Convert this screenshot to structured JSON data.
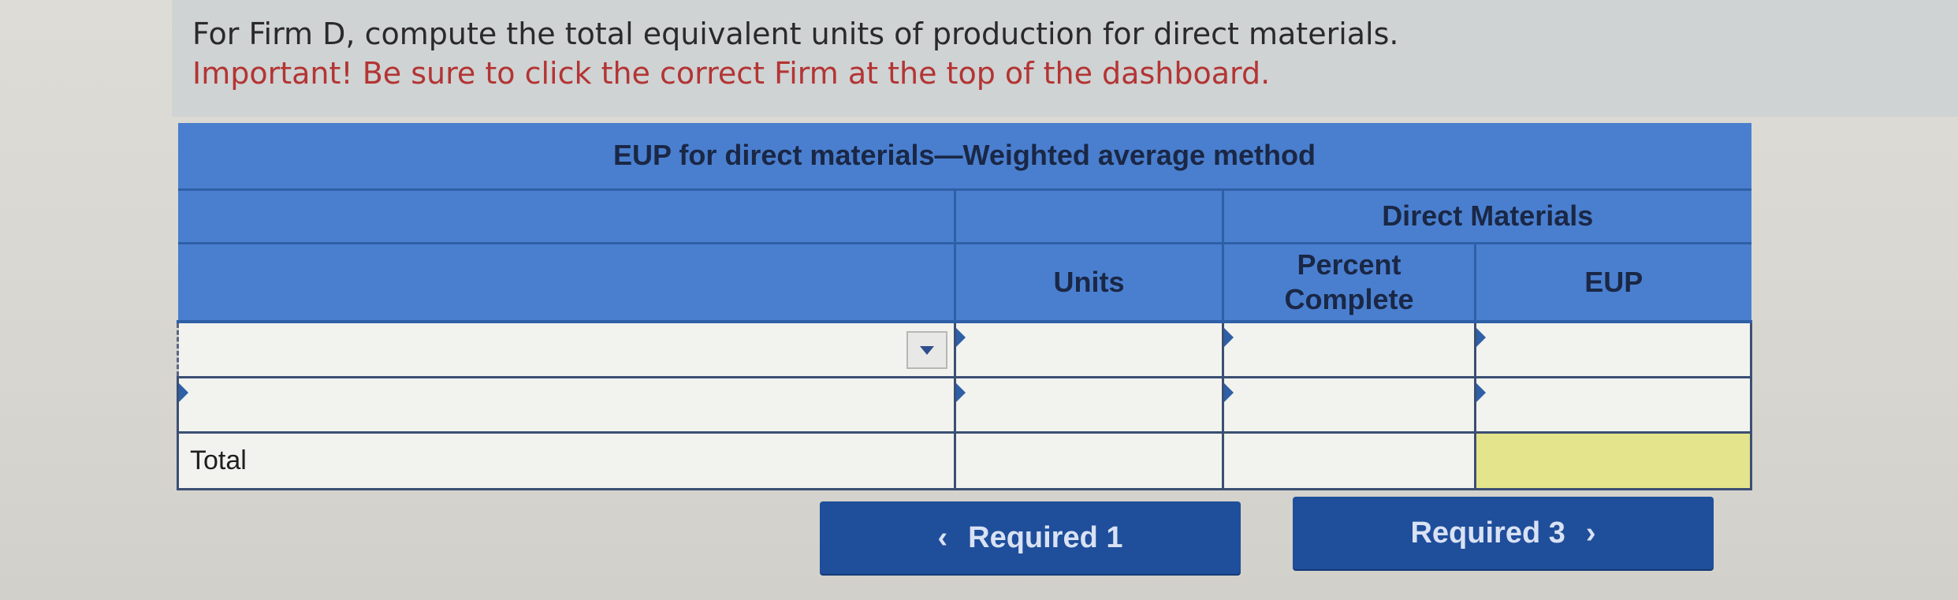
{
  "prompt": {
    "question": "For Firm D, compute the total equivalent units of production for direct materials.",
    "warning": "Important! Be sure to click the correct Firm at the top of the dashboard."
  },
  "table": {
    "title": "EUP for direct materials—Weighted average method",
    "group_header": "Direct Materials",
    "columns": {
      "units": "Units",
      "percent_line1": "Percent",
      "percent_line2": "Complete",
      "eup": "EUP"
    },
    "rows": [
      {
        "label": "",
        "units": "",
        "percent": "",
        "eup": ""
      },
      {
        "label": "",
        "units": "",
        "percent": "",
        "eup": ""
      }
    ],
    "total_label": "Total",
    "total_units": "",
    "total_eup": ""
  },
  "nav": {
    "prev_label": "Required 1",
    "next_label": "Required 3",
    "prev_icon": "chevron-left-icon",
    "next_icon": "chevron-right-icon"
  },
  "colors": {
    "header_blue": "#4a7fcf",
    "button_blue": "#1f4e9b",
    "warning_red": "#b43434",
    "total_highlight": "#e3e48c"
  }
}
